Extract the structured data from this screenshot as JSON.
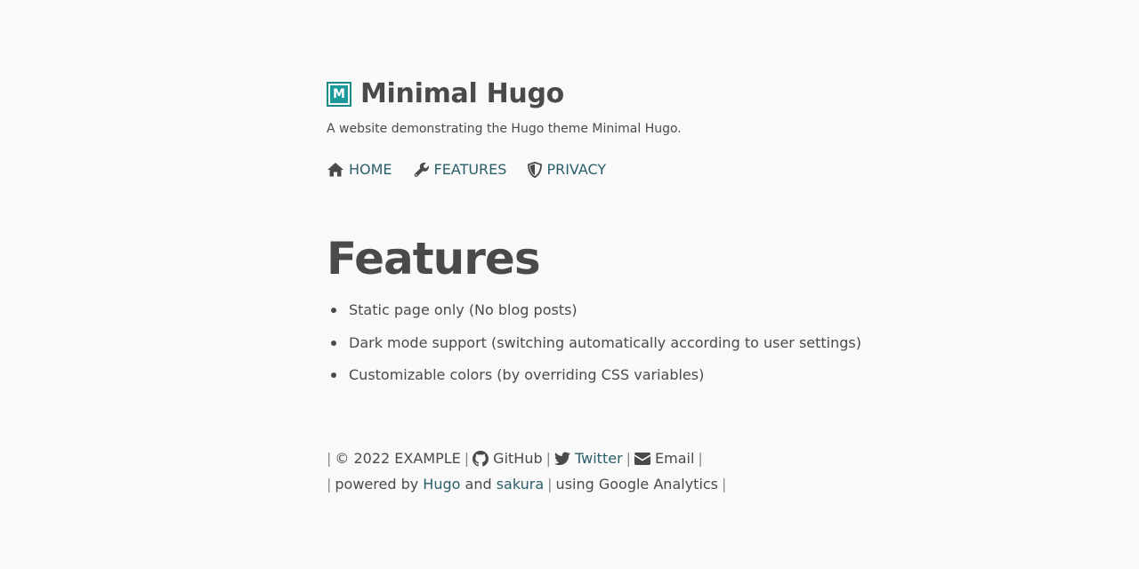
{
  "site": {
    "logo_letter": "M",
    "title": "Minimal Hugo",
    "subtitle": "A website demonstrating the Hugo theme Minimal Hugo.",
    "accent_color": "#1d9a9a",
    "link_color": "#2b5f6a"
  },
  "nav": {
    "items": [
      {
        "label": "HOME",
        "icon": "home-icon"
      },
      {
        "label": "FEATURES",
        "icon": "wrench-icon"
      },
      {
        "label": "PRIVACY",
        "icon": "shield-icon"
      }
    ]
  },
  "main": {
    "heading": "Features",
    "features": [
      "Static page only (No blog posts)",
      "Dark mode support (switching automatically according to user settings)",
      "Customizable colors (by overriding CSS variables)"
    ]
  },
  "footer": {
    "copyright": "© 2022 EXAMPLE",
    "github": "GitHub",
    "twitter": "Twitter",
    "email": "Email",
    "powered_by": "powered by",
    "hugo": "Hugo",
    "and": "and",
    "sakura": "sakura",
    "analytics": "using Google Analytics",
    "separator": "|"
  }
}
